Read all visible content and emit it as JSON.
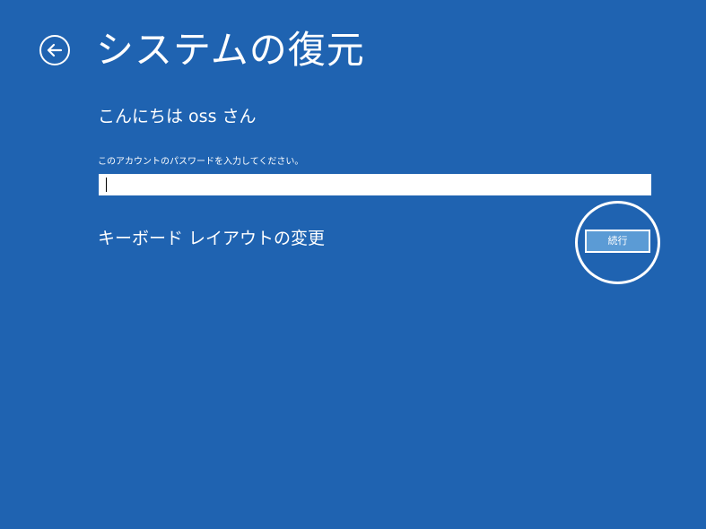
{
  "header": {
    "back_icon": "back-arrow-icon",
    "title": "システムの復元"
  },
  "main": {
    "greeting": "こんにちは oss さん",
    "password_label": "このアカウントのパスワードを入力してください。",
    "password_value": "",
    "keyboard_layout_link": "キーボード レイアウトの変更",
    "continue_label": "続行"
  },
  "colors": {
    "background": "#1f63b1",
    "button": "#5b9bd5",
    "text": "#ffffff"
  }
}
